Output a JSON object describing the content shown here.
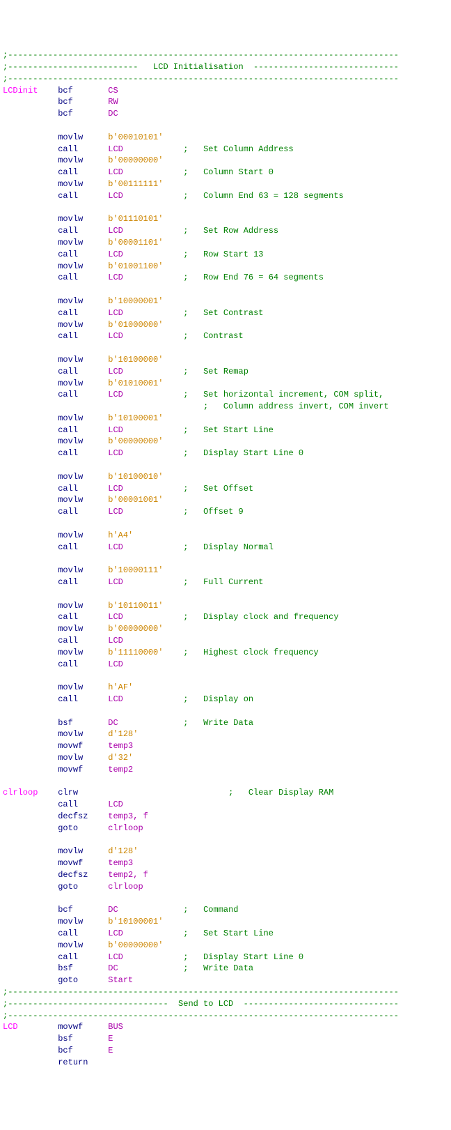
{
  "lines": [
    {
      "i": "",
      "l": "",
      "m": "",
      "o": "",
      "c": ";------------------------------------------------------------------------------"
    },
    {
      "i": "",
      "l": "",
      "m": "",
      "o": "",
      "c": ";--------------------------   LCD Initialisation  -----------------------------"
    },
    {
      "i": "",
      "l": "",
      "m": "",
      "o": "",
      "c": ";------------------------------------------------------------------------------"
    },
    {
      "i": "",
      "l": "LCDinit",
      "m": "bcf",
      "o": "CS",
      "c": ""
    },
    {
      "i": "",
      "l": "",
      "m": "bcf",
      "o": "RW",
      "c": ""
    },
    {
      "i": "",
      "l": "",
      "m": "bcf",
      "o": "DC",
      "c": ""
    },
    {
      "i": "",
      "l": "",
      "m": "",
      "o": "",
      "c": ""
    },
    {
      "i": "",
      "l": "",
      "m": "movlw",
      "o": "b'00010101'",
      "c": "",
      "lit": true
    },
    {
      "i": "",
      "l": "",
      "m": "call",
      "o": "LCD",
      "c": ";   Set Column Address"
    },
    {
      "i": "",
      "l": "",
      "m": "movlw",
      "o": "b'00000000'",
      "c": "",
      "lit": true
    },
    {
      "i": "",
      "l": "",
      "m": "call",
      "o": "LCD",
      "c": ";   Column Start 0"
    },
    {
      "i": "",
      "l": "",
      "m": "movlw",
      "o": "b'00111111'",
      "c": "",
      "lit": true
    },
    {
      "i": "",
      "l": "",
      "m": "call",
      "o": "LCD",
      "c": ";   Column End 63 = 128 segments"
    },
    {
      "i": "",
      "l": "",
      "m": "",
      "o": "",
      "c": ""
    },
    {
      "i": "",
      "l": "",
      "m": "movlw",
      "o": "b'01110101'",
      "c": "",
      "lit": true
    },
    {
      "i": "",
      "l": "",
      "m": "call",
      "o": "LCD",
      "c": ";   Set Row Address"
    },
    {
      "i": "",
      "l": "",
      "m": "movlw",
      "o": "b'00001101'",
      "c": "",
      "lit": true
    },
    {
      "i": "",
      "l": "",
      "m": "call",
      "o": "LCD",
      "c": ";   Row Start 13"
    },
    {
      "i": "",
      "l": "",
      "m": "movlw",
      "o": "b'01001100'",
      "c": "",
      "lit": true
    },
    {
      "i": "",
      "l": "",
      "m": "call",
      "o": "LCD",
      "c": ";   Row End 76 = 64 segments"
    },
    {
      "i": "",
      "l": "",
      "m": "",
      "o": "",
      "c": ""
    },
    {
      "i": "",
      "l": "",
      "m": "movlw",
      "o": "b'10000001'",
      "c": "",
      "lit": true
    },
    {
      "i": "",
      "l": "",
      "m": "call",
      "o": "LCD",
      "c": ";   Set Contrast"
    },
    {
      "i": "",
      "l": "",
      "m": "movlw",
      "o": "b'01000000'",
      "c": "",
      "lit": true
    },
    {
      "i": "",
      "l": "",
      "m": "call",
      "o": "LCD",
      "c": ";   Contrast"
    },
    {
      "i": "",
      "l": "",
      "m": "",
      "o": "",
      "c": ""
    },
    {
      "i": "",
      "l": "",
      "m": "movlw",
      "o": "b'10100000'",
      "c": "",
      "lit": true
    },
    {
      "i": "",
      "l": "",
      "m": "call",
      "o": "LCD",
      "c": ";   Set Remap"
    },
    {
      "i": "",
      "l": "",
      "m": "movlw",
      "o": "b'01010001'",
      "c": "",
      "lit": true
    },
    {
      "i": "",
      "l": "",
      "m": "call",
      "o": "LCD",
      "c": ";   Set horizontal increment, COM split,"
    },
    {
      "i": "",
      "l": "",
      "m": "",
      "o": "",
      "c": "                                        ;   Column address invert, COM invert"
    },
    {
      "i": "",
      "l": "",
      "m": "movlw",
      "o": "b'10100001'",
      "c": "",
      "lit": true
    },
    {
      "i": "",
      "l": "",
      "m": "call",
      "o": "LCD",
      "c": ";   Set Start Line"
    },
    {
      "i": "",
      "l": "",
      "m": "movlw",
      "o": "b'00000000'",
      "c": "",
      "lit": true
    },
    {
      "i": "",
      "l": "",
      "m": "call",
      "o": "LCD",
      "c": ";   Display Start Line 0"
    },
    {
      "i": "",
      "l": "",
      "m": "",
      "o": "",
      "c": ""
    },
    {
      "i": "",
      "l": "",
      "m": "movlw",
      "o": "b'10100010'",
      "c": "",
      "lit": true
    },
    {
      "i": "",
      "l": "",
      "m": "call",
      "o": "LCD",
      "c": ";   Set Offset"
    },
    {
      "i": "",
      "l": "",
      "m": "movlw",
      "o": "b'00001001'",
      "c": "",
      "lit": true
    },
    {
      "i": "",
      "l": "",
      "m": "call",
      "o": "LCD",
      "c": ";   Offset 9"
    },
    {
      "i": "",
      "l": "",
      "m": "",
      "o": "",
      "c": ""
    },
    {
      "i": "",
      "l": "",
      "m": "movlw",
      "o": "h'A4'",
      "c": "",
      "lit": true
    },
    {
      "i": "",
      "l": "",
      "m": "call",
      "o": "LCD",
      "c": ";   Display Normal"
    },
    {
      "i": "",
      "l": "",
      "m": "",
      "o": "",
      "c": ""
    },
    {
      "i": "",
      "l": "",
      "m": "movlw",
      "o": "b'10000111'",
      "c": "",
      "lit": true
    },
    {
      "i": "",
      "l": "",
      "m": "call",
      "o": "LCD",
      "c": ";   Full Current"
    },
    {
      "i": "",
      "l": "",
      "m": "",
      "o": "",
      "c": ""
    },
    {
      "i": "",
      "l": "",
      "m": "movlw",
      "o": "b'10110011'",
      "c": "",
      "lit": true
    },
    {
      "i": "",
      "l": "",
      "m": "call",
      "o": "LCD",
      "c": ";   Display clock and frequency"
    },
    {
      "i": "",
      "l": "",
      "m": "movlw",
      "o": "b'00000000'",
      "c": "",
      "lit": true
    },
    {
      "i": "",
      "l": "",
      "m": "call",
      "o": "LCD",
      "c": ""
    },
    {
      "i": "",
      "l": "",
      "m": "movlw",
      "o": "b'11110000'",
      "c": ";   Highest clock frequency",
      "lit": true,
      "csp": 4
    },
    {
      "i": "",
      "l": "",
      "m": "call",
      "o": "LCD",
      "c": ""
    },
    {
      "i": "",
      "l": "",
      "m": "",
      "o": "",
      "c": ""
    },
    {
      "i": "",
      "l": "",
      "m": "movlw",
      "o": "h'AF'",
      "c": "",
      "lit": true
    },
    {
      "i": "",
      "l": "",
      "m": "call",
      "o": "LCD",
      "c": ";   Display on"
    },
    {
      "i": "",
      "l": "",
      "m": "",
      "o": "",
      "c": ""
    },
    {
      "i": "",
      "l": "",
      "m": "bsf",
      "o": "DC",
      "c": ";   Write Data"
    },
    {
      "i": "",
      "l": "",
      "m": "movlw",
      "o": "d'128'",
      "c": "",
      "lit": true
    },
    {
      "i": "",
      "l": "",
      "m": "movwf",
      "o": "temp3",
      "c": ""
    },
    {
      "i": "",
      "l": "",
      "m": "movlw",
      "o": "d'32'",
      "c": "",
      "lit": true
    },
    {
      "i": "",
      "l": "",
      "m": "movwf",
      "o": "temp2",
      "c": ""
    },
    {
      "i": "",
      "l": "",
      "m": "",
      "o": "",
      "c": ""
    },
    {
      "i": "",
      "l": "clrloop",
      "m": "clrw",
      "o": "",
      "c": ";   Clear Display RAM",
      "cspx": true
    },
    {
      "i": "",
      "l": "",
      "m": "call",
      "o": "LCD",
      "c": ""
    },
    {
      "i": "",
      "l": "",
      "m": "decfsz",
      "o": "temp3, f",
      "c": ""
    },
    {
      "i": "",
      "l": "",
      "m": "goto",
      "o": "clrloop",
      "c": ""
    },
    {
      "i": "",
      "l": "",
      "m": "",
      "o": "",
      "c": ""
    },
    {
      "i": "",
      "l": "",
      "m": "movlw",
      "o": "d'128'",
      "c": "",
      "lit": true
    },
    {
      "i": "",
      "l": "",
      "m": "movwf",
      "o": "temp3",
      "c": ""
    },
    {
      "i": "",
      "l": "",
      "m": "decfsz",
      "o": "temp2, f",
      "c": ""
    },
    {
      "i": "",
      "l": "",
      "m": "goto",
      "o": "clrloop",
      "c": ""
    },
    {
      "i": "",
      "l": "",
      "m": "",
      "o": "",
      "c": ""
    },
    {
      "i": "",
      "l": "",
      "m": "bcf",
      "o": "DC",
      "c": ";   Command"
    },
    {
      "i": "",
      "l": "",
      "m": "movlw",
      "o": "b'10100001'",
      "c": "",
      "lit": true
    },
    {
      "i": "",
      "l": "",
      "m": "call",
      "o": "LCD",
      "c": ";   Set Start Line"
    },
    {
      "i": "",
      "l": "",
      "m": "movlw",
      "o": "b'00000000'",
      "c": "",
      "lit": true
    },
    {
      "i": "",
      "l": "",
      "m": "call",
      "o": "LCD",
      "c": ";   Display Start Line 0"
    },
    {
      "i": "",
      "l": "",
      "m": "bsf",
      "o": "DC",
      "c": ";   Write Data"
    },
    {
      "i": "",
      "l": "",
      "m": "goto",
      "o": "Start",
      "c": ""
    },
    {
      "i": "",
      "l": "",
      "m": "",
      "o": "",
      "c": ";------------------------------------------------------------------------------"
    },
    {
      "i": "",
      "l": "",
      "m": "",
      "o": "",
      "c": ";--------------------------------  Send to LCD  -------------------------------"
    },
    {
      "i": "",
      "l": "",
      "m": "",
      "o": "",
      "c": ";------------------------------------------------------------------------------"
    },
    {
      "i": "",
      "l": "LCD",
      "m": "movwf",
      "o": "BUS",
      "c": ""
    },
    {
      "i": "",
      "l": "",
      "m": "bsf",
      "o": "E",
      "c": ""
    },
    {
      "i": "",
      "l": "",
      "m": "bcf",
      "o": "E",
      "c": ""
    },
    {
      "i": "",
      "l": "",
      "m": "return",
      "o": "",
      "c": ""
    }
  ]
}
